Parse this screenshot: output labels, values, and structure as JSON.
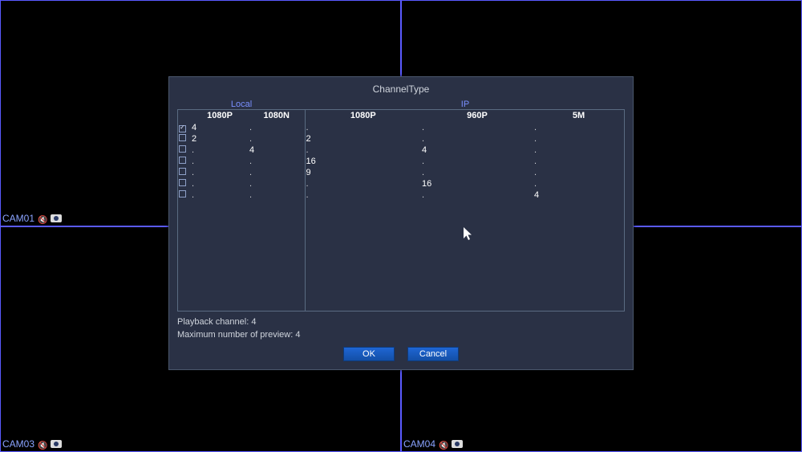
{
  "cameras": {
    "topLeft": "CAM01",
    "topRight": "",
    "bottomLeft": "CAM03",
    "bottomRight": "CAM04"
  },
  "dialog": {
    "title": "ChannelType",
    "group_local": "Local",
    "group_ip": "IP",
    "columns": {
      "c1": "1080P",
      "c2": "1080N",
      "c3": "1080P",
      "c4": "960P",
      "c5": "5M"
    },
    "rows": [
      {
        "checked": true,
        "selected": true,
        "c1": "4",
        "c2": ".",
        "c3": ".",
        "c4": ".",
        "c5": "."
      },
      {
        "checked": false,
        "selected": false,
        "c1": "2",
        "c2": ".",
        "c3": "2",
        "c4": ".",
        "c5": "."
      },
      {
        "checked": false,
        "selected": false,
        "c1": ".",
        "c2": "4",
        "c3": ".",
        "c4": "4",
        "c5": "."
      },
      {
        "checked": false,
        "selected": false,
        "c1": ".",
        "c2": ".",
        "c3": "16",
        "c4": ".",
        "c5": "."
      },
      {
        "checked": false,
        "selected": false,
        "c1": ".",
        "c2": ".",
        "c3": "9",
        "c4": ".",
        "c5": "."
      },
      {
        "checked": false,
        "selected": false,
        "c1": ".",
        "c2": ".",
        "c3": ".",
        "c4": "16",
        "c5": "."
      },
      {
        "checked": false,
        "selected": false,
        "c1": ".",
        "c2": ".",
        "c3": ".",
        "c4": ".",
        "c5": "4"
      }
    ],
    "playback_label": "Playback channel: 4",
    "preview_label": "Maximum number of preview: 4",
    "ok_label": "OK",
    "cancel_label": "Cancel"
  }
}
